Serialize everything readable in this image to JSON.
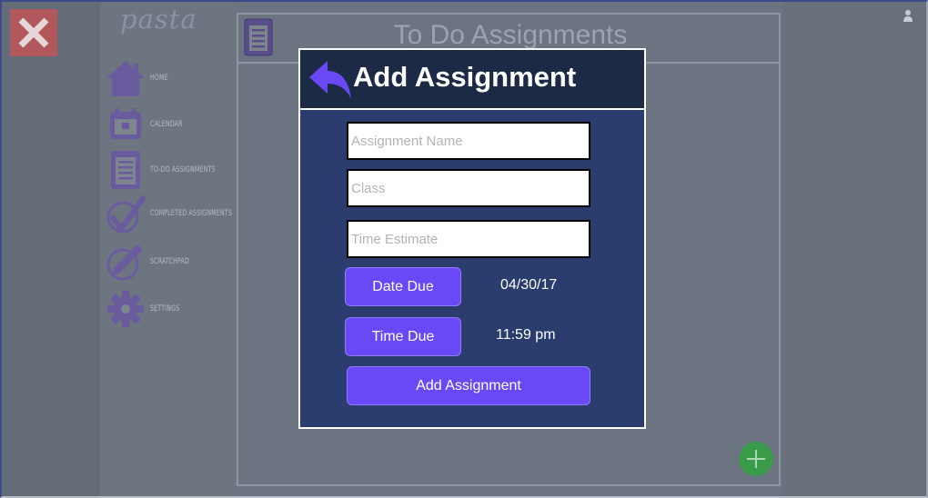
{
  "app": {
    "logo": "pasta"
  },
  "sidebar": {
    "items": [
      {
        "label": "HOME"
      },
      {
        "label": "CALENDAR"
      },
      {
        "label": "TO-DO ASSIGNMENTS"
      },
      {
        "label": "COMPLETED ASSIGNMENTS"
      },
      {
        "label": "SCRATCHPAD"
      },
      {
        "label": "SETTINGS"
      }
    ]
  },
  "main": {
    "title": "To Do Assignments"
  },
  "modal": {
    "title": "Add Assignment",
    "fields": {
      "assignment_name": {
        "placeholder": "Assignment Name",
        "value": ""
      },
      "class": {
        "placeholder": "Class",
        "value": ""
      },
      "time_estimate": {
        "placeholder": "Time Estimate",
        "value": ""
      }
    },
    "date_due": {
      "button_label": "Date Due",
      "value": "04/30/17"
    },
    "time_due": {
      "button_label": "Time Due",
      "value": "11:59 pm"
    },
    "submit_label": "Add Assignment"
  },
  "colors": {
    "accent": "#6a48f5",
    "modal_bg": "#2b3d6e",
    "modal_header_bg": "#1c2a45",
    "close_red": "#b2575c",
    "fab_green": "#3a9b4a"
  },
  "icons": {
    "close": "close-icon",
    "user": "user-icon",
    "home": "home-icon",
    "calendar": "calendar-icon",
    "todo": "clipboard-icon",
    "completed": "checkmark-icon",
    "scratchpad": "pencil-icon",
    "settings": "gear-icon",
    "back": "back-arrow-icon",
    "add": "plus-icon"
  }
}
